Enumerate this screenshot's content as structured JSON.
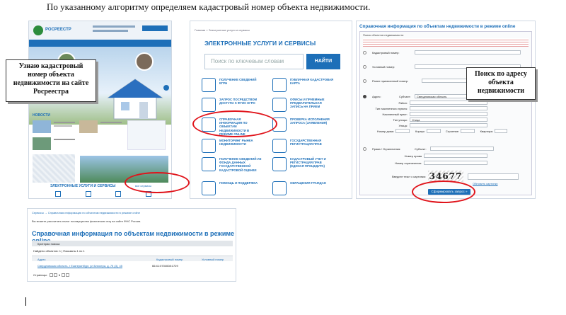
{
  "heading": "По указанному алгоритму определяем кадастровый номер объекта недвижимости.",
  "callouts": {
    "left": "Узнаю кадастровый номер объекта недвижимости на сайте Росреестра",
    "right": "Поиск по адресу объекта недвижимости"
  },
  "rosreestr_site": {
    "logo": "РОСРЕЕСТР",
    "news_title": "НОВОСТИ",
    "services_title": "ЭЛЕКТРОННЫЕ УСЛУГИ И СЕРВИСЫ",
    "all_services_link": "все сервисы"
  },
  "services_page": {
    "breadcrumb": "Главная > Электронные услуги и сервисы",
    "title": "ЭЛЕКТРОННЫЕ УСЛУГИ И СЕРВИСЫ",
    "search_placeholder": "Поиск по ключевым словам",
    "search_button": "НАЙТИ",
    "items": [
      "ПОЛУЧЕНИЕ СВЕДЕНИЙ ЕГРН",
      "ПУБЛИЧНАЯ КАДАСТРОВАЯ КАРТА",
      "ЗАПРОС ПОСРЕДСТВОМ ДОСТУПА К ФГИС ЕГРН",
      "ОФИСЫ И ПРИЕМНЫЕ ПРЕДВАРИТЕЛЬНАЯ ЗАПИСЬ НА ПРИЕМ",
      "СПРАВОЧНАЯ ИНФОРМАЦИЯ ПО ОБЪЕКТАМ НЕДВИЖИМОСТИ В РЕЖИМЕ ONLINE",
      "ПРОВЕРКА ИСПОЛНЕНИЯ ЗАПРОСА (ЗАЯВЛЕНИЯ)",
      "МОНИТОРИНГ РЫНКА НЕДВИЖИМОСТИ",
      "ГОСУДАРСТВЕННАЯ РЕГИСТРАЦИЯ ПРАВ",
      "ПОЛУЧЕНИЕ СВЕДЕНИЙ ИЗ ФОНДА ДАННЫХ ГОСУДАРСТВЕННОЙ КАДАСТРОВОЙ ОЦЕНКИ",
      "КАДАСТРОВЫЙ УЧЕТ И РЕГИСТРАЦИЯ ПРАВ (ЕДИНАЯ ПРОЦЕДУРА)",
      "ПОМОЩЬ И ПОДДЕРЖКА",
      "ОБРАЩЕНИЯ ГРАЖДАН"
    ]
  },
  "search_form": {
    "title": "Справочная информация по объектам недвижимости в режиме online",
    "section": "Поиск объектов недвижимости",
    "labels": {
      "cadastral": "Кадастровый номер:",
      "conditional": "Условный номер:",
      "former": "Ранее присвоенный номер:",
      "address": "Адрес:",
      "rights": "Права / Ограничения:"
    },
    "subject_label": "Субъект:",
    "subject_value": "Свердловская область",
    "address_fields": [
      "Район:",
      "Тип населенного пункта:",
      "Населенный пункт:",
      "Тип улицы:",
      "Улица:"
    ],
    "street_type_value": "Улица",
    "house_fields": [
      "Номер дома:",
      "Корпус:",
      "Строение:",
      "Квартира:"
    ],
    "rights_fields": [
      "Номер права",
      "Номер ограничения:"
    ],
    "captcha_label": "Введите текст с картинки:",
    "captcha_text": "34677",
    "captcha_refresh": "Обновить картинку",
    "submit": "Сформировать запрос »"
  },
  "results": {
    "breadcrumb": "Сервисы → Справочная информация по объектам недвижимости в режиме online",
    "note": "Вы можете рассчитать налог на имущество физических лиц на сайте ФНС России.",
    "title": "Справочная информация по объектам недвижимости в режиме online",
    "criteria": "Критерии поиска",
    "found": "Найдено объектов: 1 | Показаны 1 по 1",
    "columns": [
      "Адрес",
      "Кадастровый номер",
      "Условный номер"
    ],
    "row": {
      "address": "Свердловская область, г Екатеринбург, ул Блюхера, д. 75 (3), 45",
      "cadastral": "66:41:0704008:1729",
      "conditional": ""
    },
    "pages_label": "Страницы:",
    "page": "1"
  }
}
